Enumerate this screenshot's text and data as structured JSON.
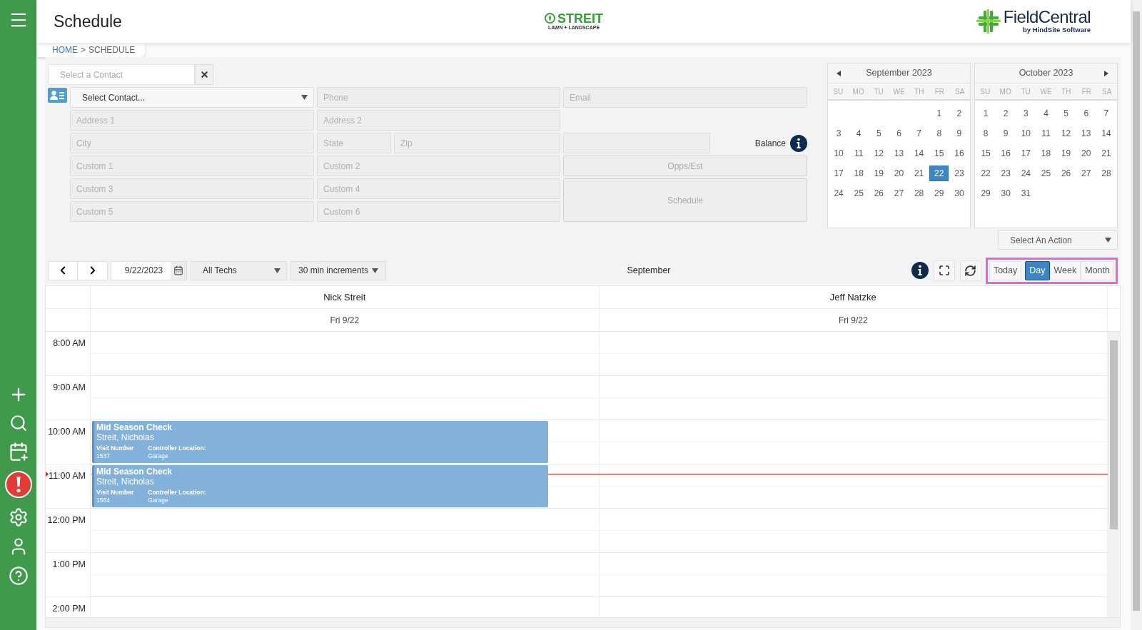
{
  "header": {
    "title": "Schedule",
    "brand": {
      "name": "STREIT",
      "tagline": "LAWN + LANDSCAPE"
    },
    "vendor": {
      "name": "FieldCentral",
      "tagline": "by HindSite Software"
    }
  },
  "breadcrumb": {
    "home": "HOME",
    "separator": ">",
    "current": "SCHEDULE"
  },
  "contact_search": {
    "placeholder": "Select a Contact"
  },
  "contact_form": {
    "select": "Select Contact...",
    "phone": {
      "placeholder": "Phone"
    },
    "email": {
      "placeholder": "Email"
    },
    "address1": {
      "placeholder": "Address 1"
    },
    "address2": {
      "placeholder": "Address 2"
    },
    "city": {
      "placeholder": "City"
    },
    "state": {
      "placeholder": "State"
    },
    "zip": {
      "placeholder": "Zip"
    },
    "custom1": {
      "placeholder": "Custom 1"
    },
    "custom2": {
      "placeholder": "Custom 2"
    },
    "custom3": {
      "placeholder": "Custom 3"
    },
    "custom4": {
      "placeholder": "Custom 4"
    },
    "custom5": {
      "placeholder": "Custom 5"
    },
    "custom6": {
      "placeholder": "Custom 6"
    },
    "balance": "Balance"
  },
  "form_buttons": [
    {
      "label": "Opps/Est",
      "disabled": true
    },
    {
      "label": "Schedule",
      "disabled": true
    }
  ],
  "calendars": [
    {
      "title": "September 2023",
      "prev_arrow": true,
      "next_arrow": false,
      "weekdays": [
        "SU",
        "MO",
        "TU",
        "WE",
        "TH",
        "FR",
        "SA"
      ],
      "weeks": [
        [
          {
            "d": "1",
            "selected": false
          },
          {
            "d": "2",
            "selected": false
          }
        ],
        [
          {
            "d": "3",
            "selected": false
          },
          {
            "d": "4",
            "selected": false
          },
          {
            "d": "5",
            "selected": false
          },
          {
            "d": "6",
            "selected": false
          },
          {
            "d": "7",
            "selected": false
          },
          {
            "d": "8",
            "selected": false
          },
          {
            "d": "9",
            "selected": false
          }
        ],
        [
          {
            "d": "10",
            "selected": false
          },
          {
            "d": "11",
            "selected": false
          },
          {
            "d": "12",
            "selected": false
          },
          {
            "d": "13",
            "selected": false
          },
          {
            "d": "14",
            "selected": false
          },
          {
            "d": "15",
            "selected": false
          },
          {
            "d": "16",
            "selected": false
          }
        ],
        [
          {
            "d": "17",
            "selected": false
          },
          {
            "d": "18",
            "selected": false
          },
          {
            "d": "19",
            "selected": false
          },
          {
            "d": "20",
            "selected": false
          },
          {
            "d": "21",
            "selected": false
          },
          {
            "d": "22",
            "selected": true
          },
          {
            "d": "23",
            "selected": false
          }
        ],
        [
          {
            "d": "24",
            "selected": false
          },
          {
            "d": "25",
            "selected": false
          },
          {
            "d": "26",
            "selected": false
          },
          {
            "d": "27",
            "selected": false
          },
          {
            "d": "28",
            "selected": false
          },
          {
            "d": "29",
            "selected": false
          },
          {
            "d": "30",
            "selected": false
          }
        ]
      ]
    },
    {
      "title": "October 2023",
      "prev_arrow": false,
      "next_arrow": true,
      "weekdays": [
        "SU",
        "MO",
        "TU",
        "WE",
        "TH",
        "FR",
        "SA"
      ],
      "weeks": [
        [
          {
            "d": "1",
            "selected": false
          },
          {
            "d": "2",
            "selected": false
          },
          {
            "d": "3",
            "selected": false
          },
          {
            "d": "4",
            "selected": false
          },
          {
            "d": "5",
            "selected": false
          },
          {
            "d": "6",
            "selected": false
          },
          {
            "d": "7",
            "selected": false
          }
        ],
        [
          {
            "d": "8",
            "selected": false
          },
          {
            "d": "9",
            "selected": false
          },
          {
            "d": "10",
            "selected": false
          },
          {
            "d": "11",
            "selected": false
          },
          {
            "d": "12",
            "selected": false
          },
          {
            "d": "13",
            "selected": false
          },
          {
            "d": "14",
            "selected": false
          }
        ],
        [
          {
            "d": "15",
            "selected": false
          },
          {
            "d": "16",
            "selected": false
          },
          {
            "d": "17",
            "selected": false
          },
          {
            "d": "18",
            "selected": false
          },
          {
            "d": "19",
            "selected": false
          },
          {
            "d": "20",
            "selected": false
          },
          {
            "d": "21",
            "selected": false
          }
        ],
        [
          {
            "d": "22",
            "selected": false
          },
          {
            "d": "23",
            "selected": false
          },
          {
            "d": "24",
            "selected": false
          },
          {
            "d": "25",
            "selected": false
          },
          {
            "d": "26",
            "selected": false
          },
          {
            "d": "27",
            "selected": false
          },
          {
            "d": "28",
            "selected": false
          }
        ],
        [
          {
            "d": "29",
            "selected": false
          },
          {
            "d": "30",
            "selected": false
          },
          {
            "d": "31",
            "selected": false
          }
        ]
      ]
    }
  ],
  "action_select": "Select An Action",
  "toolbar": {
    "date": "9/22/2023",
    "techs": "All Techs",
    "increment": "30 min increments",
    "period": "September",
    "views": [
      {
        "label": "Today",
        "selected": false
      },
      {
        "label": "Day",
        "selected": true
      },
      {
        "label": "Week",
        "selected": false
      },
      {
        "label": "Month",
        "selected": false
      }
    ]
  },
  "schedule": {
    "techs": [
      {
        "name": "Nick Streit",
        "date": "Fri 9/22"
      },
      {
        "name": "Jeff Natzke",
        "date": "Fri 9/22"
      }
    ],
    "rows": [
      {
        "time": "8:00 AM"
      },
      {
        "time": "9:00 AM"
      },
      {
        "time": "10:00 AM",
        "event": {
          "title": "Mid Season Check",
          "customer": "Streit, Nicholas",
          "fields": [
            {
              "label": "Visit Number",
              "value": "1537"
            },
            {
              "label": "Controller Location:",
              "value": "Garage"
            }
          ]
        }
      },
      {
        "time": "11:00 AM",
        "now_line": true,
        "event": {
          "title": "Mid Season Check",
          "customer": "Streit, Nicholas",
          "fields": [
            {
              "label": "Visit Number",
              "value": "1564"
            },
            {
              "label": "Controller Location:",
              "value": "Garage"
            }
          ]
        }
      },
      {
        "time": "12:00 PM"
      },
      {
        "time": "1:00 PM"
      },
      {
        "time": "2:00 PM"
      }
    ]
  }
}
